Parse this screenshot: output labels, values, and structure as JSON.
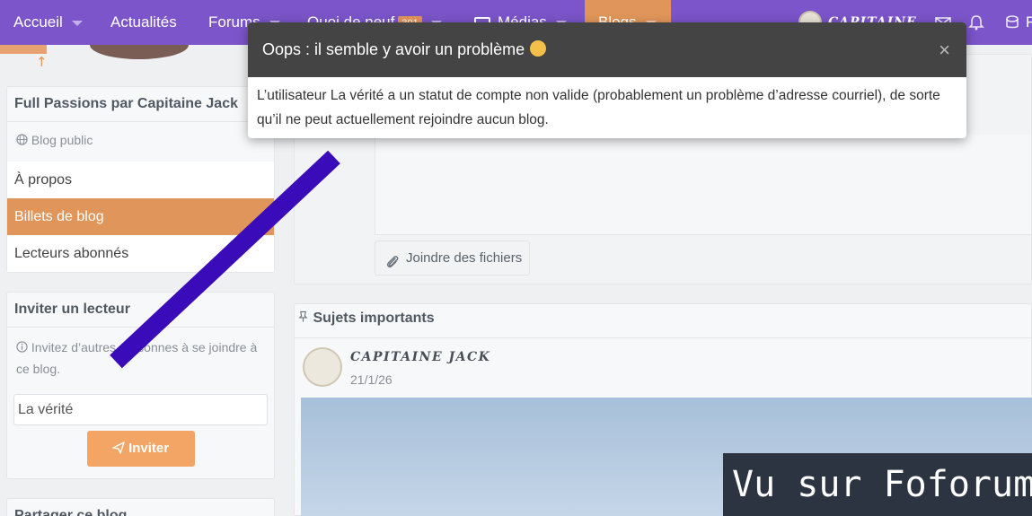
{
  "nav": {
    "items": [
      {
        "label": "Accueil"
      },
      {
        "label": "Actualités"
      },
      {
        "label": "Forums"
      },
      {
        "label": "Quoi de neuf",
        "badge": "301"
      },
      {
        "label": "Médias"
      },
      {
        "label": "Blogs"
      }
    ],
    "user_name": "CAPITAINE",
    "trailing_label": "F"
  },
  "sidebar": {
    "blog_block": {
      "title": "Full Passions par Capitaine Jack",
      "visibility": "Blog public",
      "links": [
        {
          "label": "À propos"
        },
        {
          "label": "Billets de blog",
          "active": true
        },
        {
          "label": "Lecteurs abonnés"
        }
      ]
    },
    "invite_block": {
      "title": "Inviter un lecteur",
      "help": "Invitez d’autres personnes à se joindre à ce blog.",
      "input_value": "La vérité",
      "button_label": "Inviter"
    },
    "share_block": {
      "title": "Partager ce blog"
    }
  },
  "main": {
    "attach_label": "Joindre des fichiers",
    "sticky_title": "Sujets importants",
    "post": {
      "author": "CAPITAINE JACK",
      "date": "21/1/26"
    }
  },
  "modal": {
    "title": "Oops : il semble y avoir un problème",
    "close_symbol": "×",
    "message": "L’utilisateur La vérité a un statut de compte non valide (probablement un problème d’adresse courriel), de sorte qu’il ne peut actuellement rejoindre aucun blog."
  },
  "watermark": {
    "text": "Vu sur Foforum"
  },
  "colors": {
    "nav_bg": "#7b55c9",
    "accent_orange": "#e0965a",
    "button_orange": "#f3a566",
    "modal_header": "#444444",
    "slash": "#3a0bb8"
  }
}
